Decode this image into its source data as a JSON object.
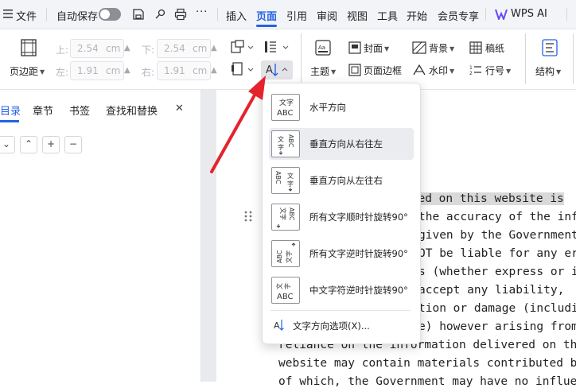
{
  "menu": {
    "file": "文件",
    "autosave": "自动保存",
    "more": "···",
    "tabs": [
      "插入",
      "页面",
      "引用",
      "审阅",
      "视图",
      "工具",
      "开始",
      "会员专享"
    ],
    "active_tab": "页面",
    "wps_ai": "WPS AI"
  },
  "ribbon": {
    "margins": "页边距",
    "top": {
      "label": "上:",
      "value": "2.54",
      "unit": "cm"
    },
    "bottom": {
      "label": "下:",
      "value": "2.54",
      "unit": "cm"
    },
    "left": {
      "label": "左:",
      "value": "1.91",
      "unit": "cm"
    },
    "right": {
      "label": "右:",
      "value": "1.91",
      "unit": "cm"
    },
    "theme": "主题",
    "cover": "封面",
    "page_border": "页面边框",
    "background": "背景",
    "watermark": "水印",
    "draft_paper": "稿纸",
    "line_number": "行号",
    "structure": "结构"
  },
  "pane": {
    "tabs": [
      "目录",
      "章节",
      "书签",
      "查找和替换"
    ],
    "close": "✕",
    "controls": [
      "⌄",
      "⌃",
      "+",
      "−"
    ]
  },
  "dropdown": {
    "items": [
      {
        "label": "水平方向",
        "icon": "文字ABC"
      },
      {
        "label": "垂直方向从右往左",
        "icon": "ABC文字"
      },
      {
        "label": "垂直方向从左往右",
        "icon": "ABC文字"
      },
      {
        "label": "所有文字顺时针旋转90°",
        "icon": "ABC文字"
      },
      {
        "label": "所有文字逆时针旋转90°",
        "icon": "ABC文字"
      },
      {
        "label": "中文字符逆时针旋转90°",
        "icon": "文字ABC"
      }
    ],
    "options": "文字方向选项(X)..."
  },
  "document": {
    "lines": [
      "ided on this website is",
      "the accuracy of the inf",
      "given by the Government",
      "OT be liable for any err",
      "s (whether express or in",
      " accept any liability,",
      "tion or damage (includin",
      "e) however arising from",
      "reliance on the information delivered on th",
      "website may contain materials contributed by",
      "of which, the Government may have no influe"
    ]
  },
  "colors": {
    "accent": "#2462e6",
    "arrow": "#e5232d"
  }
}
